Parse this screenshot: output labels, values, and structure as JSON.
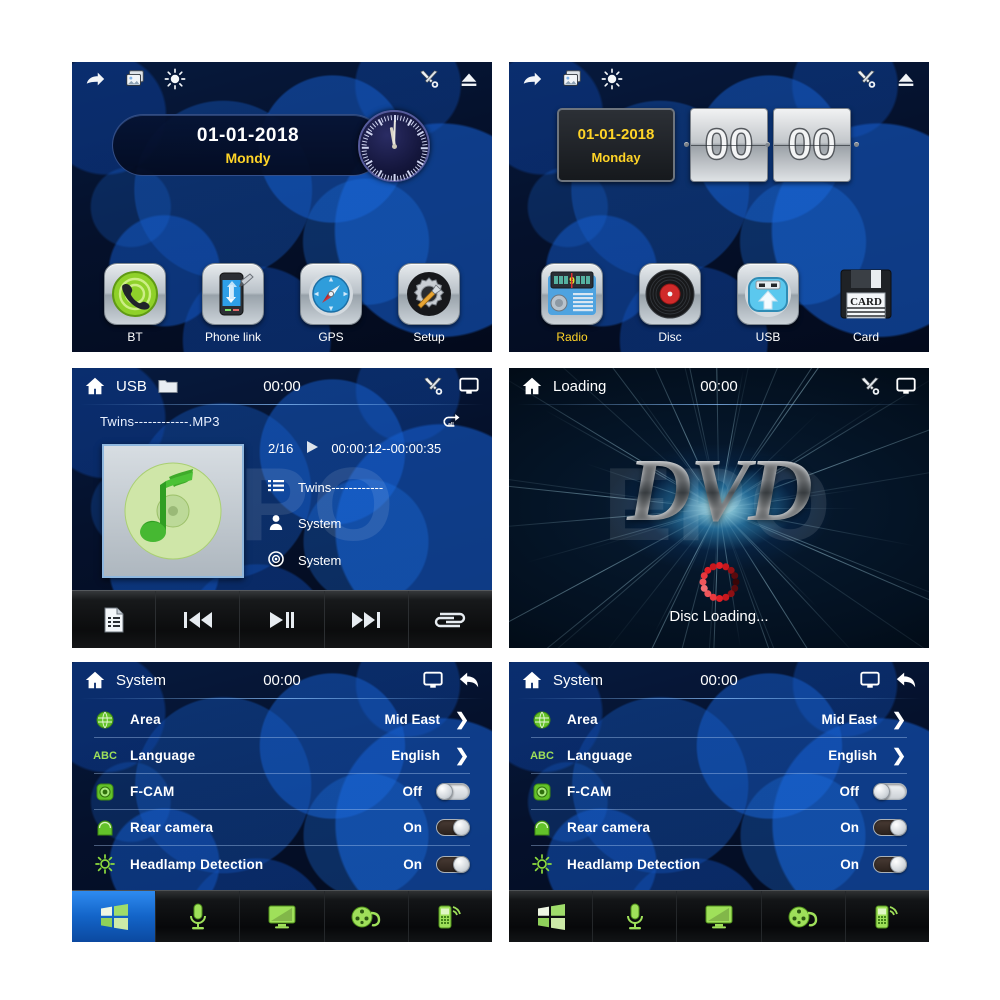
{
  "panels": {
    "home_clock": {
      "name": "Home screen with analog clock",
      "topbar": [
        {
          "icon": "share-arrow-icon"
        },
        {
          "icon": "photos-icon"
        },
        {
          "icon": "brightness-icon"
        },
        {
          "icon": "tools-icon"
        },
        {
          "icon": "eject-icon"
        }
      ],
      "date": "01-01-2018",
      "weekday": "Mondy",
      "apps": [
        {
          "label": "BT",
          "icon": "bluetooth-phone-icon",
          "selected": false
        },
        {
          "label": "Phone link",
          "icon": "phone-link-icon",
          "selected": false
        },
        {
          "label": "GPS",
          "icon": "compass-icon",
          "selected": false
        },
        {
          "label": "Setup",
          "icon": "gear-wrench-icon",
          "selected": false
        }
      ]
    },
    "home_flip": {
      "name": "Home screen with flip clock",
      "topbar": [
        {
          "icon": "share-arrow-icon"
        },
        {
          "icon": "photos-icon"
        },
        {
          "icon": "brightness-icon"
        },
        {
          "icon": "tools-icon"
        },
        {
          "icon": "eject-icon"
        }
      ],
      "date": "01-01-2018",
      "weekday": "Monday",
      "hours": "00",
      "minutes": "00",
      "apps": [
        {
          "label": "Radio",
          "icon": "radio-icon",
          "selected": true
        },
        {
          "label": "Disc",
          "icon": "vinyl-disc-icon",
          "selected": false
        },
        {
          "label": "USB",
          "icon": "usb-drive-icon",
          "selected": false
        },
        {
          "label": "Card",
          "icon": "sd-card-icon",
          "selected": false
        }
      ]
    },
    "usb_player": {
      "name": "USB music player",
      "header": {
        "home_icon": "home-icon",
        "source": "USB",
        "folder_icon": "folder-icon",
        "clock": "00:00",
        "tools_icon": "tools-icon",
        "screen_icon": "monitor-icon"
      },
      "track_file": "Twins------------.MP3",
      "repeat_icon": "repeat-all-icon",
      "cover_icon": "music-note-cd-icon",
      "track_index": "2/16",
      "play_icon": "play-icon",
      "time_range": "00:00:12--00:00:35",
      "meta": [
        {
          "icon": "playlist-icon",
          "value": "Twins------------"
        },
        {
          "icon": "artist-icon",
          "value": "System"
        },
        {
          "icon": "album-icon",
          "value": "System"
        }
      ],
      "transport": [
        {
          "icon": "playlist-file-icon",
          "label": "Playlist"
        },
        {
          "icon": "previous-track-icon",
          "label": "Previous"
        },
        {
          "icon": "play-pause-icon",
          "label": "Play/Pause"
        },
        {
          "icon": "next-track-icon",
          "label": "Next"
        },
        {
          "icon": "repeat-icon",
          "label": "Repeat"
        }
      ]
    },
    "dvd_loading": {
      "name": "DVD disc loading screen",
      "header": {
        "home_icon": "home-icon",
        "source": "Loading",
        "clock": "00:00",
        "tools_icon": "tools-icon",
        "screen_icon": "monitor-icon"
      },
      "logo": "DVD",
      "status": "Disc Loading..."
    },
    "system_settings_a": {
      "name": "System settings (Windows tab active)",
      "header": {
        "home_icon": "home-icon",
        "title": "System",
        "clock": "00:00",
        "screen_icon": "monitor-icon",
        "back_icon": "back-arrow-icon"
      },
      "rows": [
        {
          "icon": "globe-icon",
          "label": "Area",
          "value": "Mid East",
          "control": "chevron"
        },
        {
          "icon": "abc-icon",
          "label": "Language",
          "value": "English",
          "control": "chevron"
        },
        {
          "icon": "front-cam-icon",
          "label": "F-CAM",
          "value": "Off",
          "control": "toggle-off"
        },
        {
          "icon": "rear-cam-icon",
          "label": "Rear camera",
          "value": "On",
          "control": "toggle-on"
        },
        {
          "icon": "headlamp-icon",
          "label": "Headlamp Detection",
          "value": "On",
          "control": "toggle-on"
        }
      ],
      "taskbar": [
        {
          "icon": "windows-icon",
          "label": "System",
          "active": true
        },
        {
          "icon": "microphone-icon",
          "label": "Voice",
          "active": false
        },
        {
          "icon": "monitor-icon",
          "label": "Display",
          "active": false
        },
        {
          "icon": "film-reel-icon",
          "label": "Video",
          "active": false
        },
        {
          "icon": "mobile-phone-icon",
          "label": "Phone",
          "active": false
        }
      ]
    },
    "system_settings_b": {
      "name": "System settings (no tab active)",
      "header": {
        "home_icon": "home-icon",
        "title": "System",
        "clock": "00:00",
        "screen_icon": "monitor-icon",
        "back_icon": "back-arrow-icon"
      },
      "rows": [
        {
          "icon": "globe-icon",
          "label": "Area",
          "value": "Mid East",
          "control": "chevron"
        },
        {
          "icon": "abc-icon",
          "label": "Language",
          "value": "English",
          "control": "chevron"
        },
        {
          "icon": "front-cam-icon",
          "label": "F-CAM",
          "value": "Off",
          "control": "toggle-off"
        },
        {
          "icon": "rear-cam-icon",
          "label": "Rear camera",
          "value": "On",
          "control": "toggle-on"
        },
        {
          "icon": "headlamp-icon",
          "label": "Headlamp Detection",
          "value": "On",
          "control": "toggle-on"
        }
      ],
      "taskbar": [
        {
          "icon": "windows-icon",
          "label": "System",
          "active": false
        },
        {
          "icon": "microphone-icon",
          "label": "Voice",
          "active": false
        },
        {
          "icon": "monitor-icon",
          "label": "Display",
          "active": false
        },
        {
          "icon": "film-reel-icon",
          "label": "Video",
          "active": false
        },
        {
          "icon": "mobile-phone-icon",
          "label": "Phone",
          "active": false
        }
      ]
    }
  },
  "watermark": "EPO",
  "colors": {
    "accent_yellow": "#ffd427",
    "accent_blue": "#1364c8",
    "text_white": "#ffffff",
    "icon_green": "#7ed321",
    "spinner_red": "#e01f26"
  }
}
